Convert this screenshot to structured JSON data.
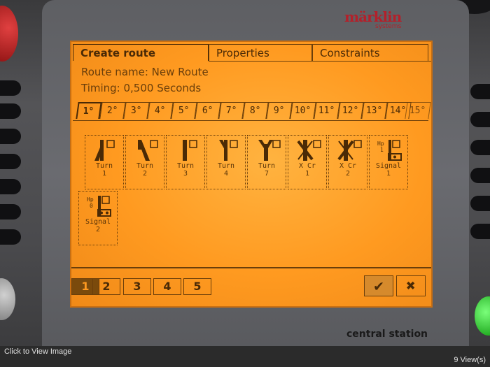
{
  "brand": {
    "logo_text": "märklin",
    "logo_sub": "systems",
    "device_label": "central station"
  },
  "screen": {
    "tabs": [
      {
        "label": "Create route",
        "active": true
      },
      {
        "label": "Properties",
        "active": false
      },
      {
        "label": "Constraints",
        "active": false
      }
    ],
    "route_name": "Route name: New Route",
    "timing": "Timing: 0,500 Seconds",
    "steps": [
      "1°",
      "2°",
      "3°",
      "4°",
      "5°",
      "6°",
      "7°",
      "8°",
      "9°",
      "10°",
      "11°",
      "12°",
      "13°",
      "14°",
      "15°"
    ],
    "active_step": "1°",
    "items": [
      {
        "line1": "Turn",
        "line2": "1",
        "icon": "turnout-left-icon"
      },
      {
        "line1": "Turn",
        "line2": "2",
        "icon": "turnout-right-icon"
      },
      {
        "line1": "Turn",
        "line2": "3",
        "icon": "turnout-straight-icon"
      },
      {
        "line1": "Turn",
        "line2": "4",
        "icon": "turnout-y-icon"
      },
      {
        "line1": "Turn",
        "line2": "7",
        "icon": "turnout-y-icon"
      },
      {
        "line1": "X Cr",
        "line2": "1",
        "icon": "crossing-icon"
      },
      {
        "line1": "X Cr",
        "line2": "2",
        "icon": "crossing-icon"
      },
      {
        "line1": "Signal",
        "line2": "1",
        "icon": "signal-icon",
        "hp": "Hp",
        "hp_num": "1"
      },
      {
        "line1": "Signal",
        "line2": "2",
        "icon": "signal-icon",
        "hp": "Hp",
        "hp_num": "0"
      }
    ],
    "pages": [
      "1",
      "2",
      "3",
      "4",
      "5"
    ],
    "active_page": "1",
    "ok_glyph": "✔",
    "cancel_glyph": "✖"
  },
  "viewer": {
    "click_text": "Click to View Image",
    "views": "9 View(s)"
  },
  "colors": {
    "screen": "#ff9a20",
    "ink": "#4a2a06",
    "logo": "#b3202a"
  }
}
